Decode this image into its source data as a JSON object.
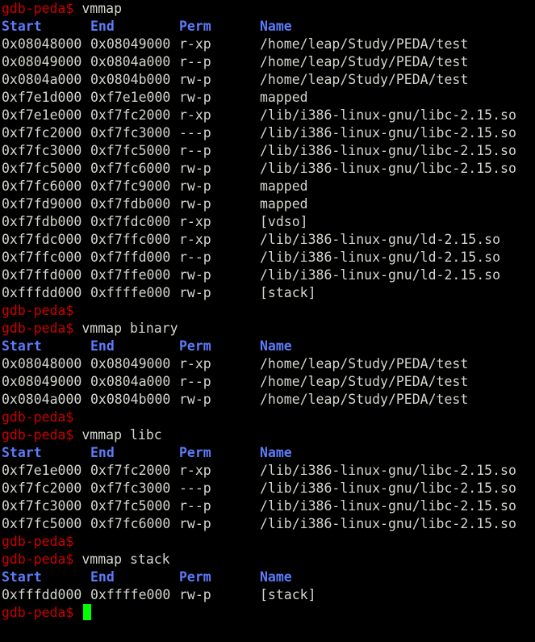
{
  "colors": {
    "background": "#000000",
    "prompt": "#cc0000",
    "header": "#5c7cfa",
    "text": "#d3d7cf",
    "cursor": "#00ff00"
  },
  "prompt": "gdb-peda$",
  "header": {
    "start": "Start",
    "end": "End",
    "perm": "Perm",
    "name": "Name"
  },
  "blocks": [
    {
      "command": "vmmap",
      "rows": [
        {
          "start": "0x08048000",
          "end": "0x08049000",
          "perm": "r-xp",
          "name": "/home/leap/Study/PEDA/test"
        },
        {
          "start": "0x08049000",
          "end": "0x0804a000",
          "perm": "r--p",
          "name": "/home/leap/Study/PEDA/test"
        },
        {
          "start": "0x0804a000",
          "end": "0x0804b000",
          "perm": "rw-p",
          "name": "/home/leap/Study/PEDA/test"
        },
        {
          "start": "0xf7e1d000",
          "end": "0xf7e1e000",
          "perm": "rw-p",
          "name": "mapped"
        },
        {
          "start": "0xf7e1e000",
          "end": "0xf7fc2000",
          "perm": "r-xp",
          "name": "/lib/i386-linux-gnu/libc-2.15.so"
        },
        {
          "start": "0xf7fc2000",
          "end": "0xf7fc3000",
          "perm": "---p",
          "name": "/lib/i386-linux-gnu/libc-2.15.so"
        },
        {
          "start": "0xf7fc3000",
          "end": "0xf7fc5000",
          "perm": "r--p",
          "name": "/lib/i386-linux-gnu/libc-2.15.so"
        },
        {
          "start": "0xf7fc5000",
          "end": "0xf7fc6000",
          "perm": "rw-p",
          "name": "/lib/i386-linux-gnu/libc-2.15.so"
        },
        {
          "start": "0xf7fc6000",
          "end": "0xf7fc9000",
          "perm": "rw-p",
          "name": "mapped"
        },
        {
          "start": "0xf7fd9000",
          "end": "0xf7fdb000",
          "perm": "rw-p",
          "name": "mapped"
        },
        {
          "start": "0xf7fdb000",
          "end": "0xf7fdc000",
          "perm": "r-xp",
          "name": "[vdso]"
        },
        {
          "start": "0xf7fdc000",
          "end": "0xf7ffc000",
          "perm": "r-xp",
          "name": "/lib/i386-linux-gnu/ld-2.15.so"
        },
        {
          "start": "0xf7ffc000",
          "end": "0xf7ffd000",
          "perm": "r--p",
          "name": "/lib/i386-linux-gnu/ld-2.15.so"
        },
        {
          "start": "0xf7ffd000",
          "end": "0xf7ffe000",
          "perm": "rw-p",
          "name": "/lib/i386-linux-gnu/ld-2.15.so"
        },
        {
          "start": "0xfffdd000",
          "end": "0xffffe000",
          "perm": "rw-p",
          "name": "[stack]"
        }
      ]
    },
    {
      "command": "vmmap binary",
      "rows": [
        {
          "start": "0x08048000",
          "end": "0x08049000",
          "perm": "r-xp",
          "name": "/home/leap/Study/PEDA/test"
        },
        {
          "start": "0x08049000",
          "end": "0x0804a000",
          "perm": "r--p",
          "name": "/home/leap/Study/PEDA/test"
        },
        {
          "start": "0x0804a000",
          "end": "0x0804b000",
          "perm": "rw-p",
          "name": "/home/leap/Study/PEDA/test"
        }
      ]
    },
    {
      "command": "vmmap libc",
      "rows": [
        {
          "start": "0xf7e1e000",
          "end": "0xf7fc2000",
          "perm": "r-xp",
          "name": "/lib/i386-linux-gnu/libc-2.15.so"
        },
        {
          "start": "0xf7fc2000",
          "end": "0xf7fc3000",
          "perm": "---p",
          "name": "/lib/i386-linux-gnu/libc-2.15.so"
        },
        {
          "start": "0xf7fc3000",
          "end": "0xf7fc5000",
          "perm": "r--p",
          "name": "/lib/i386-linux-gnu/libc-2.15.so"
        },
        {
          "start": "0xf7fc5000",
          "end": "0xf7fc6000",
          "perm": "rw-p",
          "name": "/lib/i386-linux-gnu/libc-2.15.so"
        }
      ]
    },
    {
      "command": "vmmap stack",
      "rows": [
        {
          "start": "0xfffdd000",
          "end": "0xffffe000",
          "perm": "rw-p",
          "name": "[stack]"
        }
      ]
    }
  ]
}
